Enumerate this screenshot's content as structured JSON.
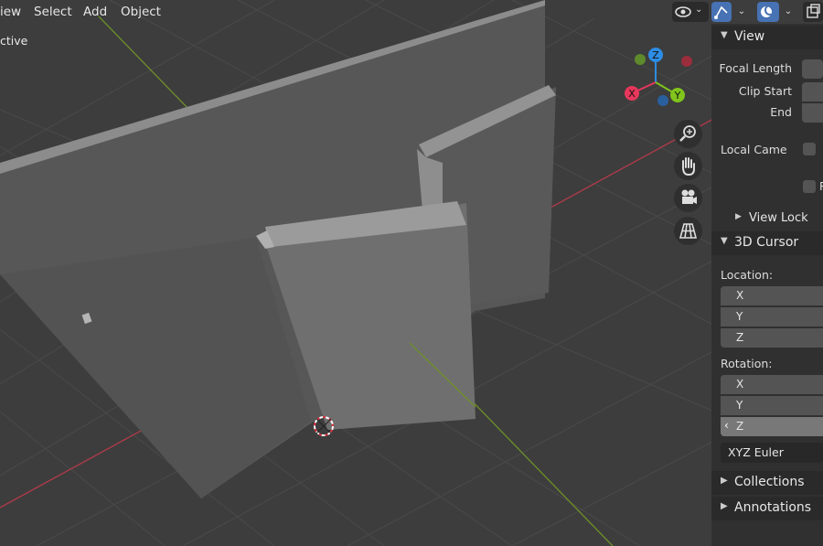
{
  "menu": {
    "view": "iew",
    "select": "Select",
    "add": "Add",
    "object": "Object"
  },
  "viewport": {
    "mode_label": "ctive"
  },
  "gizmo": {
    "x": "X",
    "y": "Y",
    "z": "Z"
  },
  "panel": {
    "view_section": {
      "title": "View",
      "focal_length": "Focal Length",
      "clip_start": "Clip Start",
      "end": "End",
      "local_camera": "Local Came",
      "extra_check": "R",
      "view_lock": "View Lock"
    },
    "cursor_section": {
      "title": "3D Cursor",
      "location": "Location:",
      "loc_x": "X",
      "loc_y": "Y",
      "loc_z": "Z",
      "rotation": "Rotation:",
      "rot_x": "X",
      "rot_y": "Y",
      "rot_z": "Z",
      "mode": "XYZ Euler"
    },
    "collections": "Collections",
    "annotations": "Annotations"
  },
  "colors": {
    "x_axis": "#e8375c",
    "y_axis": "#80c41c",
    "z_axis": "#2d8ce3",
    "header_active": "#4772b3"
  }
}
